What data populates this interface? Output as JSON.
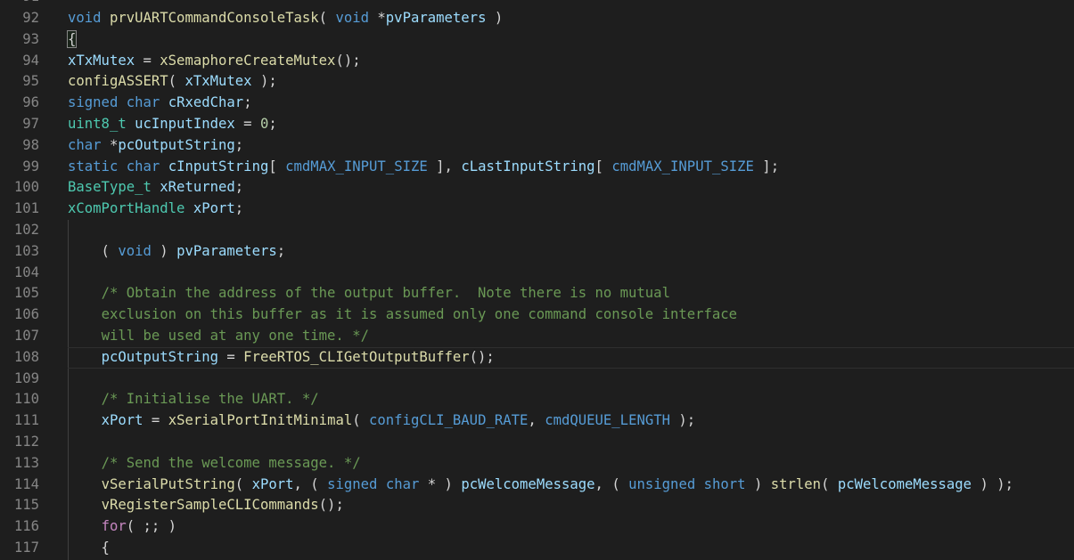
{
  "editor": {
    "top_partial_line": "91",
    "lines": [
      {
        "n": "92",
        "tokens": [
          [
            "kw",
            "void"
          ],
          [
            "pl",
            " "
          ],
          [
            "fn",
            "prvUARTCommandConsoleTask"
          ],
          [
            "pl",
            "( "
          ],
          [
            "kw",
            "void"
          ],
          [
            "pl",
            " *"
          ],
          [
            "var",
            "pvParameters"
          ],
          [
            "pl",
            " )"
          ]
        ]
      },
      {
        "n": "93",
        "tokens": [
          [
            "brace",
            "{"
          ]
        ]
      },
      {
        "n": "94",
        "tokens": [
          [
            "var",
            "xTxMutex"
          ],
          [
            "pl",
            " = "
          ],
          [
            "fn",
            "xSemaphoreCreateMutex"
          ],
          [
            "pl",
            "();"
          ]
        ]
      },
      {
        "n": "95",
        "tokens": [
          [
            "fn",
            "configASSERT"
          ],
          [
            "pl",
            "( "
          ],
          [
            "var",
            "xTxMutex"
          ],
          [
            "pl",
            " );"
          ]
        ]
      },
      {
        "n": "96",
        "tokens": [
          [
            "kw",
            "signed"
          ],
          [
            "pl",
            " "
          ],
          [
            "kw",
            "char"
          ],
          [
            "pl",
            " "
          ],
          [
            "var",
            "cRxedChar"
          ],
          [
            "pl",
            ";"
          ]
        ]
      },
      {
        "n": "97",
        "tokens": [
          [
            "ty",
            "uint8_t"
          ],
          [
            "pl",
            " "
          ],
          [
            "var",
            "ucInputIndex"
          ],
          [
            "pl",
            " = "
          ],
          [
            "num",
            "0"
          ],
          [
            "pl",
            ";"
          ]
        ]
      },
      {
        "n": "98",
        "tokens": [
          [
            "kw",
            "char"
          ],
          [
            "pl",
            " *"
          ],
          [
            "var",
            "pcOutputString"
          ],
          [
            "pl",
            ";"
          ]
        ]
      },
      {
        "n": "99",
        "tokens": [
          [
            "kw",
            "static"
          ],
          [
            "pl",
            " "
          ],
          [
            "kw",
            "char"
          ],
          [
            "pl",
            " "
          ],
          [
            "var",
            "cInputString"
          ],
          [
            "pl",
            "[ "
          ],
          [
            "mac",
            "cmdMAX_INPUT_SIZE"
          ],
          [
            "pl",
            " ], "
          ],
          [
            "var",
            "cLastInputString"
          ],
          [
            "pl",
            "[ "
          ],
          [
            "mac",
            "cmdMAX_INPUT_SIZE"
          ],
          [
            "pl",
            " ];"
          ]
        ]
      },
      {
        "n": "100",
        "tokens": [
          [
            "ty",
            "BaseType_t"
          ],
          [
            "pl",
            " "
          ],
          [
            "var",
            "xReturned"
          ],
          [
            "pl",
            ";"
          ]
        ]
      },
      {
        "n": "101",
        "tokens": [
          [
            "ty",
            "xComPortHandle"
          ],
          [
            "pl",
            " "
          ],
          [
            "var",
            "xPort"
          ],
          [
            "pl",
            ";"
          ]
        ]
      },
      {
        "n": "102",
        "tokens": []
      },
      {
        "n": "103",
        "tokens": [
          [
            "pl",
            "    ( "
          ],
          [
            "kw",
            "void"
          ],
          [
            "pl",
            " ) "
          ],
          [
            "var",
            "pvParameters"
          ],
          [
            "pl",
            ";"
          ]
        ]
      },
      {
        "n": "104",
        "tokens": []
      },
      {
        "n": "105",
        "tokens": [
          [
            "pl",
            "    "
          ],
          [
            "cm",
            "/* Obtain the address of the output buffer.  Note there is no mutual"
          ]
        ]
      },
      {
        "n": "106",
        "tokens": [
          [
            "pl",
            "    "
          ],
          [
            "cm",
            "exclusion on this buffer as it is assumed only one command console interface"
          ]
        ]
      },
      {
        "n": "107",
        "tokens": [
          [
            "pl",
            "    "
          ],
          [
            "cm",
            "will be used at any one time. */"
          ]
        ]
      },
      {
        "n": "108",
        "tokens": [
          [
            "pl",
            "    "
          ],
          [
            "var",
            "pcOutputString"
          ],
          [
            "pl",
            " = "
          ],
          [
            "fn",
            "FreeRTOS_CLIGetOutputBuffer"
          ],
          [
            "pl",
            "();"
          ]
        ],
        "current": true
      },
      {
        "n": "109",
        "tokens": []
      },
      {
        "n": "110",
        "tokens": [
          [
            "pl",
            "    "
          ],
          [
            "cm",
            "/* Initialise the UART. */"
          ]
        ]
      },
      {
        "n": "111",
        "tokens": [
          [
            "pl",
            "    "
          ],
          [
            "var",
            "xPort"
          ],
          [
            "pl",
            " = "
          ],
          [
            "fn",
            "xSerialPortInitMinimal"
          ],
          [
            "pl",
            "( "
          ],
          [
            "mac",
            "configCLI_BAUD_RATE"
          ],
          [
            "pl",
            ", "
          ],
          [
            "mac",
            "cmdQUEUE_LENGTH"
          ],
          [
            "pl",
            " );"
          ]
        ]
      },
      {
        "n": "112",
        "tokens": []
      },
      {
        "n": "113",
        "tokens": [
          [
            "pl",
            "    "
          ],
          [
            "cm",
            "/* Send the welcome message. */"
          ]
        ]
      },
      {
        "n": "114",
        "tokens": [
          [
            "pl",
            "    "
          ],
          [
            "fn",
            "vSerialPutString"
          ],
          [
            "pl",
            "( "
          ],
          [
            "var",
            "xPort"
          ],
          [
            "pl",
            ", ( "
          ],
          [
            "kw",
            "signed"
          ],
          [
            "pl",
            " "
          ],
          [
            "kw",
            "char"
          ],
          [
            "pl",
            " * ) "
          ],
          [
            "var",
            "pcWelcomeMessage"
          ],
          [
            "pl",
            ", ( "
          ],
          [
            "kw",
            "unsigned"
          ],
          [
            "pl",
            " "
          ],
          [
            "kw",
            "short"
          ],
          [
            "pl",
            " ) "
          ],
          [
            "fn",
            "strlen"
          ],
          [
            "pl",
            "( "
          ],
          [
            "var",
            "pcWelcomeMessage"
          ],
          [
            "pl",
            " ) );"
          ]
        ]
      },
      {
        "n": "115",
        "tokens": [
          [
            "pl",
            "    "
          ],
          [
            "fn",
            "vRegisterSampleCLICommands"
          ],
          [
            "pl",
            "();"
          ]
        ]
      },
      {
        "n": "116",
        "tokens": [
          [
            "pl",
            "    "
          ],
          [
            "ctl",
            "for"
          ],
          [
            "pl",
            "( ;; )"
          ]
        ]
      },
      {
        "n": "117",
        "tokens": [
          [
            "pl",
            "    {"
          ]
        ]
      }
    ]
  },
  "colors": {
    "background": "#1e1e1e",
    "line_number": "#858585",
    "keyword": "#569cd6",
    "control": "#c586c0",
    "type": "#4ec9b0",
    "function": "#dcdcaa",
    "variable": "#9cdcfe",
    "number": "#b5cea8",
    "comment": "#6a9955",
    "plain": "#d4d4d4"
  }
}
